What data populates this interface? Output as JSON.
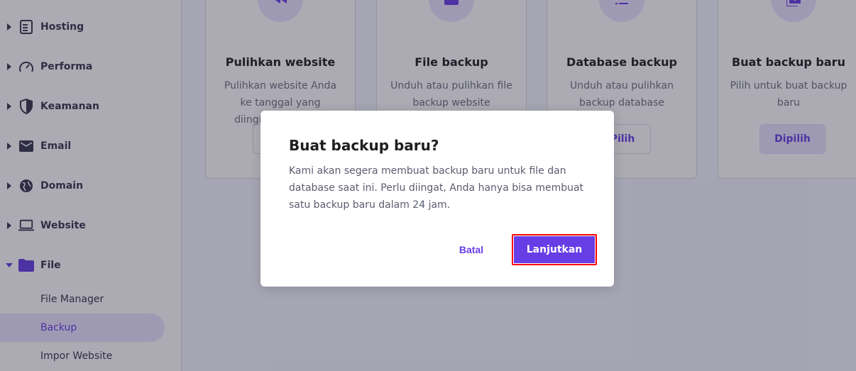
{
  "sidebar": {
    "items": [
      {
        "label": "Hosting",
        "icon": "server-icon"
      },
      {
        "label": "Performa",
        "icon": "speedometer-icon"
      },
      {
        "label": "Keamanan",
        "icon": "shield-icon"
      },
      {
        "label": "Email",
        "icon": "envelope-icon"
      },
      {
        "label": "Domain",
        "icon": "globe-icon"
      },
      {
        "label": "Website",
        "icon": "laptop-icon"
      },
      {
        "label": "File",
        "icon": "folder-icon"
      }
    ],
    "sub_items": [
      {
        "label": "File Manager"
      },
      {
        "label": "Backup"
      },
      {
        "label": "Impor Website"
      }
    ]
  },
  "cards": [
    {
      "title": "Pulihkan website",
      "desc": "Pulihkan website Anda ke tanggal yang diinginkan dengan",
      "icon": "rewind-icon",
      "button": ""
    },
    {
      "title": "File backup",
      "desc": "Unduh atau pulihkan file backup website",
      "icon": "folder-icon",
      "button": ""
    },
    {
      "title": "Database backup",
      "desc": "Unduh atau pulihkan backup database",
      "icon": "list-icon",
      "button": "Pilih"
    },
    {
      "title": "Buat backup baru",
      "desc": "Pilih untuk buat backup baru",
      "icon": "add-backup-icon",
      "button": "Dipilih"
    }
  ],
  "modal": {
    "title": "Buat backup baru?",
    "text": "Kami akan segera membuat backup baru untuk file dan database saat ini. Perlu diingat, Anda hanya bisa membuat satu backup baru dalam 24 jam.",
    "cancel_label": "Batal",
    "continue_label": "Lanjutkan"
  },
  "colors": {
    "accent": "#673de6",
    "highlight_border": "#ff0000"
  }
}
